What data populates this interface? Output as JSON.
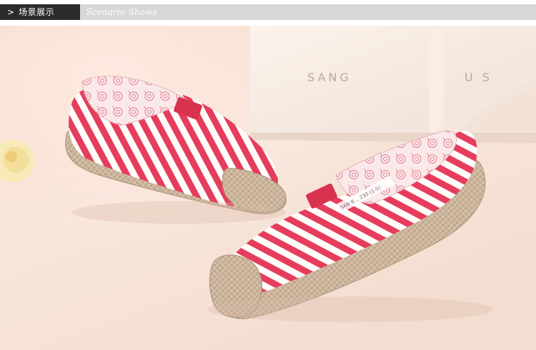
{
  "header": {
    "chevron": ">",
    "title_cn": "场景展示",
    "title_en": "Scenario Shows"
  },
  "photo": {
    "box_brand_text": "SANG",
    "box_brand_text_right": "U S",
    "label_text": "SAN B... 230 (1-5)"
  },
  "colors": {
    "header_dark": "#2b2b2b",
    "header_light": "#d7d7d7",
    "stripe_red": "#e63d5c",
    "stripe_white": "#fffdfa",
    "jute": "#c9b29a",
    "background_peach": "#f7e7dd"
  }
}
